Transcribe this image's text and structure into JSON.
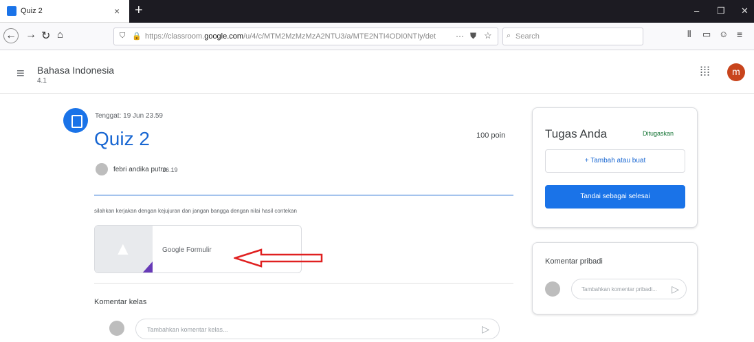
{
  "browser": {
    "tab_title": "Quiz 2",
    "tab_close": "×",
    "new_tab": "+",
    "url_pre": "https://classroom.",
    "url_domain": "google.com",
    "url_post": "/u/4/c/MTM2MzMzMzA2NTU3/a/MTE2NTI4ODI0NTIy/det",
    "search_placeholder": "Search",
    "minimize": "–",
    "maximize": "❐",
    "close": "✕"
  },
  "appbar": {
    "class_title": "Bahasa Indonesia",
    "class_section": "4.1",
    "avatar_letter": "m"
  },
  "assignment": {
    "due": "Tenggat: 19 Jun 23.59",
    "title": "Quiz 2",
    "points": "100 poin",
    "author": "febri andika putra",
    "time": "16.19",
    "instructions": "silahkan kerjakan dengan kejujuran dan jangan bangga dengan nilai hasil contekan",
    "attachment_label": "Google Formulir",
    "class_comments_label": "Komentar kelas",
    "class_comment_placeholder": "Tambahkan komentar kelas..."
  },
  "your_work": {
    "title": "Tugas Anda",
    "status": "Ditugaskan",
    "add_label": "+ Tambah atau buat",
    "mark_done_label": "Tandai sebagai selesai"
  },
  "private_comments": {
    "title": "Komentar pribadi",
    "placeholder": "Tambahkan komentar pribadi..."
  },
  "colors": {
    "accent": "#1a73e8",
    "avatar": "#c8441c",
    "status": "#137333",
    "annotation_arrow": "#e02020"
  }
}
